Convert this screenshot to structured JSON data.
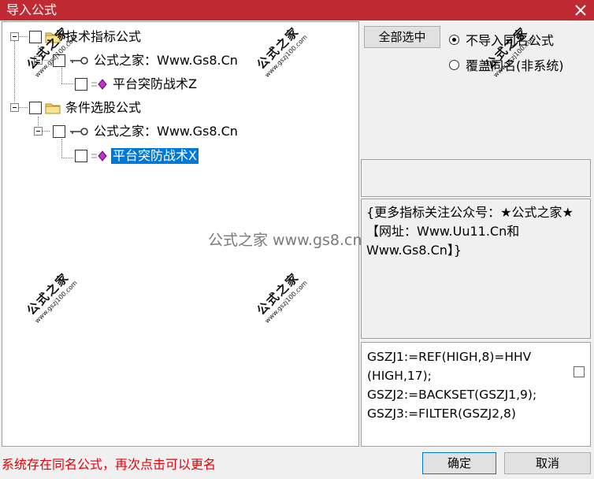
{
  "window": {
    "title": "导入公式"
  },
  "tree": {
    "groups": [
      {
        "label": "技术指标公式",
        "source": {
          "label": "公式之家：Www.Gs8.Cn"
        },
        "formula": {
          "label": "平台突防战术Z"
        }
      },
      {
        "label": "条件选股公式",
        "source": {
          "label": "公式之家：Www.Gs8.Cn"
        },
        "formula": {
          "label": "平台突防战术X"
        }
      }
    ]
  },
  "watermark": {
    "cn": "公式之家",
    "url": "www.gszj100.com",
    "center": "公式之家 www.gs8.cn"
  },
  "options": {
    "select_all": "全部选中",
    "radio_skip": "不导入同名公式",
    "radio_overwrite": "覆盖同名(非系统)"
  },
  "description": "{更多指标关注公众号：★公式之家★ 【网址：Www.Uu11.Cn和Www.Gs8.Cn】}",
  "formula_lines": [
    "GSZJ1:=REF(HIGH,8)=HHV",
    "(HIGH,17);",
    "GSZJ2:=BACKSET(GSZJ1,9);",
    "GSZJ3:=FILTER(GSZJ2,8)"
  ],
  "status": "系统存在同名公式，再次点击可以更名",
  "buttons": {
    "ok": "确定",
    "cancel": "取消"
  },
  "colors": {
    "titlebar": "#bf2a33",
    "selection": "#0078d7",
    "status_text": "#e8000b",
    "folder": "#f5d36b",
    "gem": "#c02fd0"
  }
}
